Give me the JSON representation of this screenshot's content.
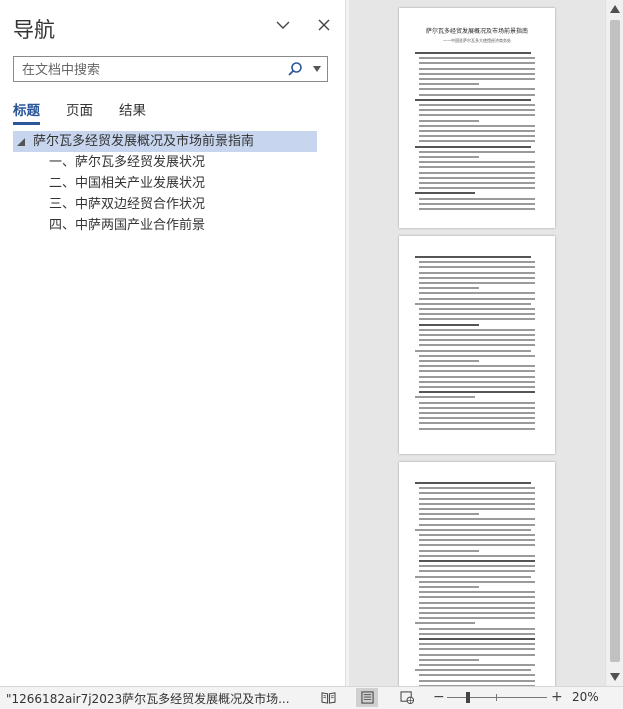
{
  "nav": {
    "title": "导航",
    "search_placeholder": "在文档中搜索",
    "tabs": [
      {
        "label": "标题"
      },
      {
        "label": "页面"
      },
      {
        "label": "结果"
      }
    ],
    "headings": [
      {
        "label": "萨尔瓦多经贸发展概况及市场前景指南"
      },
      {
        "label": "一、萨尔瓦多经贸发展状况"
      },
      {
        "label": "二、中国相关产业发展状况"
      },
      {
        "label": "三、中萨双边经贸合作状况"
      },
      {
        "label": "四、中萨两国产业合作前景"
      }
    ]
  },
  "document": {
    "page1_title": "萨尔瓦多经贸发展概况及市场前景指南",
    "page1_subtitle": "——中国驻萨尔瓦多大使馆经济商务处"
  },
  "status": {
    "file": "\"1266182air7j2023萨尔瓦多经贸发展概况及市场...",
    "zoom": "20%"
  }
}
